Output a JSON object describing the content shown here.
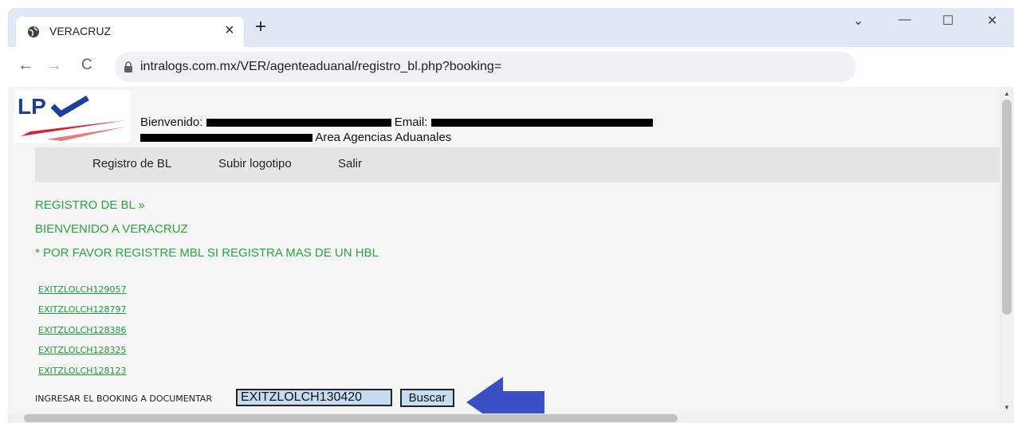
{
  "browser": {
    "tab_title": "VERACRUZ",
    "tab_close": "×",
    "new_tab": "+",
    "url": "intralogs.com.mx/VER/agenteaduanal/registro_bl.php?booking=",
    "window_controls": {
      "dropdown": "⌄",
      "minimize": "—",
      "maximize": "☐",
      "close": "✕"
    },
    "nav": {
      "back": "←",
      "forward": "→",
      "reload": "C"
    }
  },
  "header": {
    "logo_text": "LP",
    "welcome_label": "Bienvenido:",
    "email_label": "Email:",
    "area_label": "Area Agencias Aduanales"
  },
  "menu": {
    "items": [
      "Registro de BL",
      "Subir logotipo",
      "Salir"
    ]
  },
  "content": {
    "section_title": "REGISTRO DE BL »",
    "welcome_text": "BIENVENIDO A VERACRUZ",
    "notice": "* POR FAVOR REGISTRE MBL SI REGISTRA MAS DE UN HBL",
    "bookings": [
      "EXITZLOLCH129057",
      "EXITZLOLCH128797",
      "EXITZLOLCH128386",
      "EXITZLOLCH128325",
      "EXITZLOLCH128123"
    ]
  },
  "search": {
    "label": "INGRESAR EL BOOKING A DOCUMENTAR",
    "value": "EXITZLOLCH130420",
    "button": "Buscar"
  },
  "colors": {
    "green_text": "#2aa43f",
    "annotation_arrow": "#3b4fc4",
    "logo_blue": "#1a3f9c",
    "logo_red": "#d9232e"
  }
}
